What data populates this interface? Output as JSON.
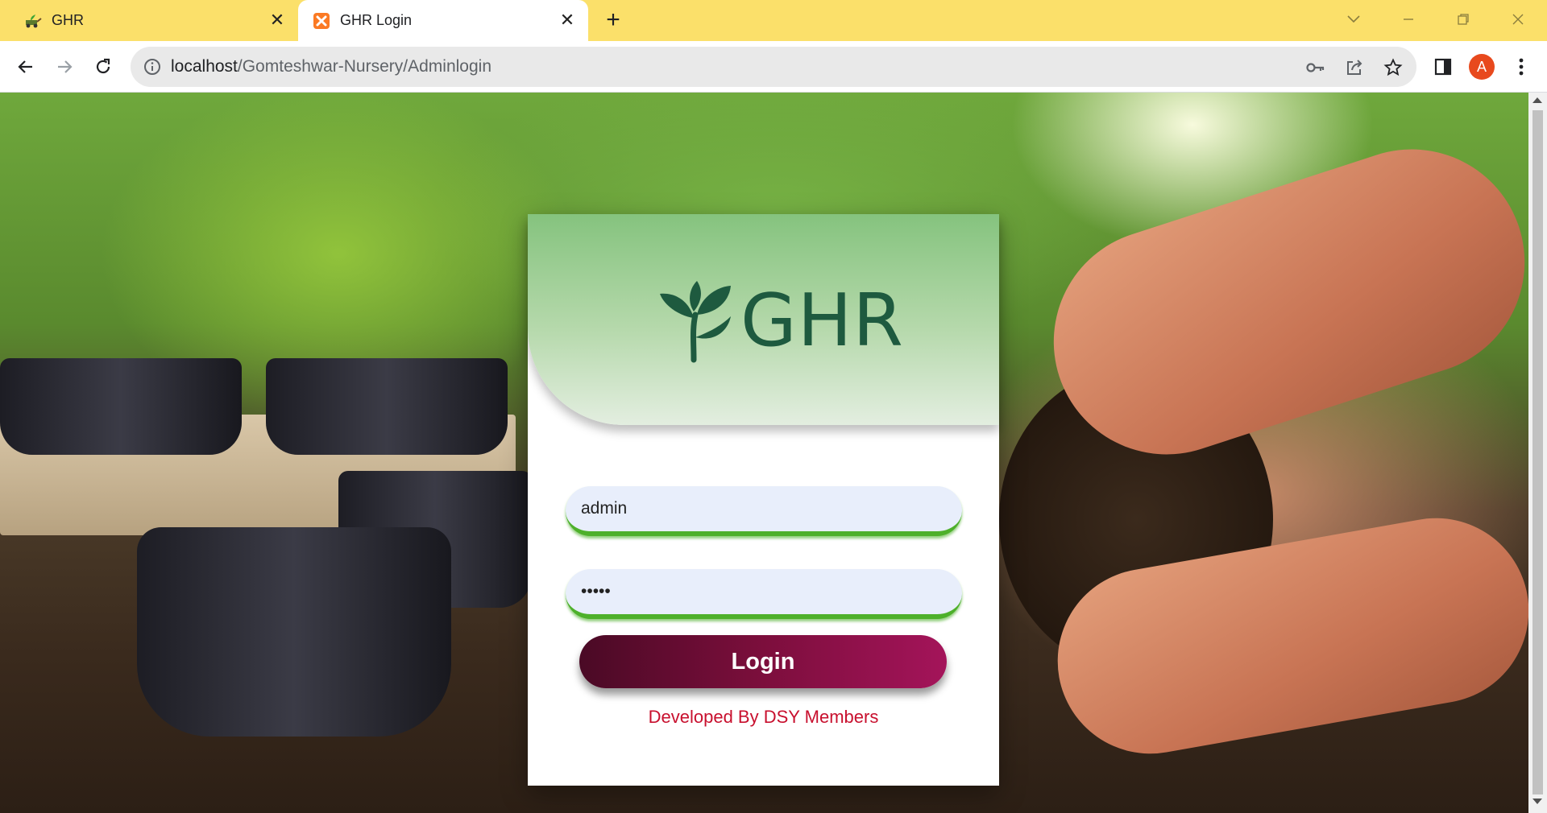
{
  "browser": {
    "tabs": [
      {
        "title": "GHR",
        "active": false,
        "favicon": "plant-cart-icon"
      },
      {
        "title": "GHR Login",
        "active": true,
        "favicon": "xampp-icon"
      }
    ],
    "url": {
      "host": "localhost",
      "path": "/Gomteshwar-Nursery/Adminlogin"
    },
    "profile_initial": "A"
  },
  "login": {
    "brand": "GHR",
    "username_value": "admin",
    "password_value": "•••••",
    "login_label": "Login",
    "credit": "Developed By DSY Members"
  },
  "colors": {
    "tabstrip": "#fbe06a",
    "field_underline": "#4db02a",
    "button_gradient_start": "#4a0a25",
    "button_gradient_end": "#a4145a",
    "credit_text": "#c8102e",
    "logo": "#1e5a3f"
  }
}
